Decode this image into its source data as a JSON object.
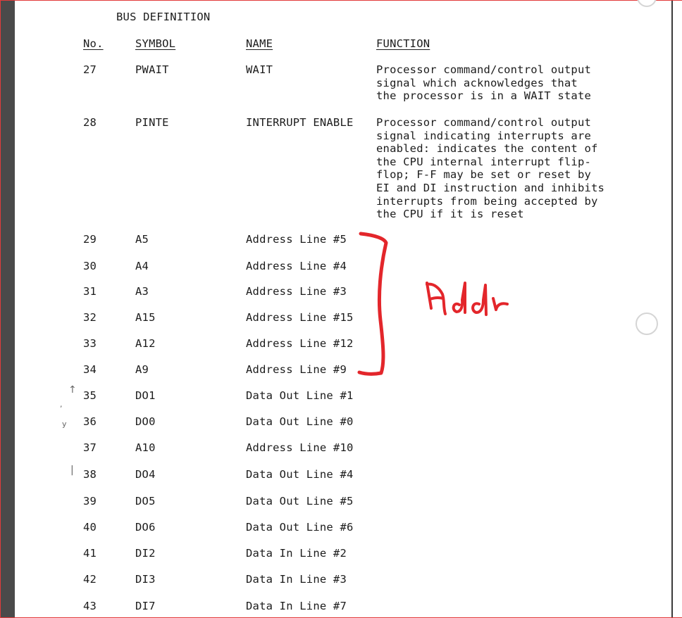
{
  "document": {
    "title": "BUS DEFINITION",
    "columns": {
      "no": "No.",
      "symbol": "SYMBOL",
      "name": "NAME",
      "function": "FUNCTION"
    },
    "rows": [
      {
        "no": "27",
        "symbol": "PWAIT",
        "name": "WAIT",
        "function": "Processor command/control output\nsignal which acknowledges that\nthe processor is in a WAIT state"
      },
      {
        "no": "28",
        "symbol": "PINTE",
        "name": "INTERRUPT ENABLE",
        "function": "Processor command/control output\nsignal indicating interrupts are\nenabled:  indicates the content of\nthe CPU internal interrupt flip-\nflop; F-F may be set or reset by\nEI and DI instruction and inhibits\ninterrupts from being accepted by\nthe CPU if it is reset"
      },
      {
        "no": "29",
        "symbol": "A5",
        "name": "Address Line #5",
        "function": ""
      },
      {
        "no": "30",
        "symbol": "A4",
        "name": "Address Line #4",
        "function": ""
      },
      {
        "no": "31",
        "symbol": "A3",
        "name": "Address Line #3",
        "function": ""
      },
      {
        "no": "32",
        "symbol": "A15",
        "name": "Address Line #15",
        "function": ""
      },
      {
        "no": "33",
        "symbol": "A12",
        "name": "Address Line #12",
        "function": ""
      },
      {
        "no": "34",
        "symbol": "A9",
        "name": "Address Line #9",
        "function": ""
      },
      {
        "no": "35",
        "symbol": "DO1",
        "name": "Data Out Line #1",
        "function": ""
      },
      {
        "no": "36",
        "symbol": "DO0",
        "name": "Data Out Line #0",
        "function": ""
      },
      {
        "no": "37",
        "symbol": "A10",
        "name": "Address Line #10",
        "function": ""
      },
      {
        "no": "38",
        "symbol": "DO4",
        "name": "Data Out Line #4",
        "function": ""
      },
      {
        "no": "39",
        "symbol": "DO5",
        "name": "Data Out Line #5",
        "function": ""
      },
      {
        "no": "40",
        "symbol": "DO6",
        "name": "Data Out Line #6",
        "function": ""
      },
      {
        "no": "41",
        "symbol": "DI2",
        "name": "Data In Line #2",
        "function": ""
      },
      {
        "no": "42",
        "symbol": "DI3",
        "name": "Data In Line #3",
        "function": ""
      },
      {
        "no": "43",
        "symbol": "DI7",
        "name": "Data In Line #7",
        "function": ""
      }
    ],
    "annotation": {
      "text": "Addr",
      "color": "#e3262b"
    }
  }
}
